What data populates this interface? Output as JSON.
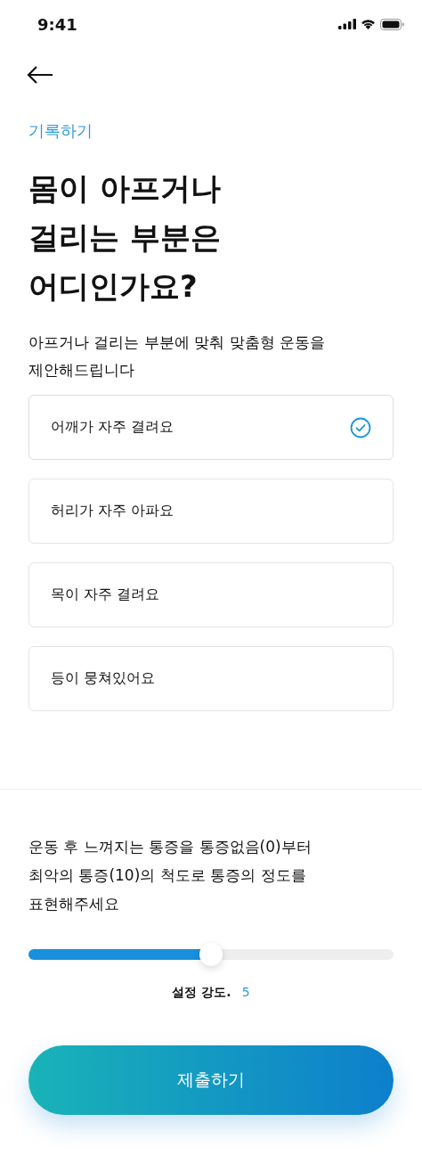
{
  "status_bar": {
    "time": "9:41"
  },
  "header": {
    "section_label": "기록하기"
  },
  "title_lines": [
    "몸이 아프거나",
    "걸리는 부분은",
    "어디인가요?"
  ],
  "subtitle_lines": [
    "아프거나 걸리는 부분에 맞춰 맞춤형 운동을",
    "제안해드립니다"
  ],
  "options": [
    {
      "label": "어깨가 자주 결려요",
      "selected": true
    },
    {
      "label": "허리가 자주 아파요",
      "selected": false
    },
    {
      "label": "목이 자주 결려요",
      "selected": false
    },
    {
      "label": "등이 뭉쳐있어요",
      "selected": false
    }
  ],
  "pain_scale": {
    "description_lines": [
      "운동 후 느껴지는 통증을 통증없음(0)부터",
      "최악의 통증(10)의 척도로 통증의 정도를",
      "표현해주세요"
    ],
    "level": 0.5,
    "reading_label": "설정 강도.",
    "reading_value": "5"
  },
  "submit_button": {
    "label": "제출하기"
  }
}
